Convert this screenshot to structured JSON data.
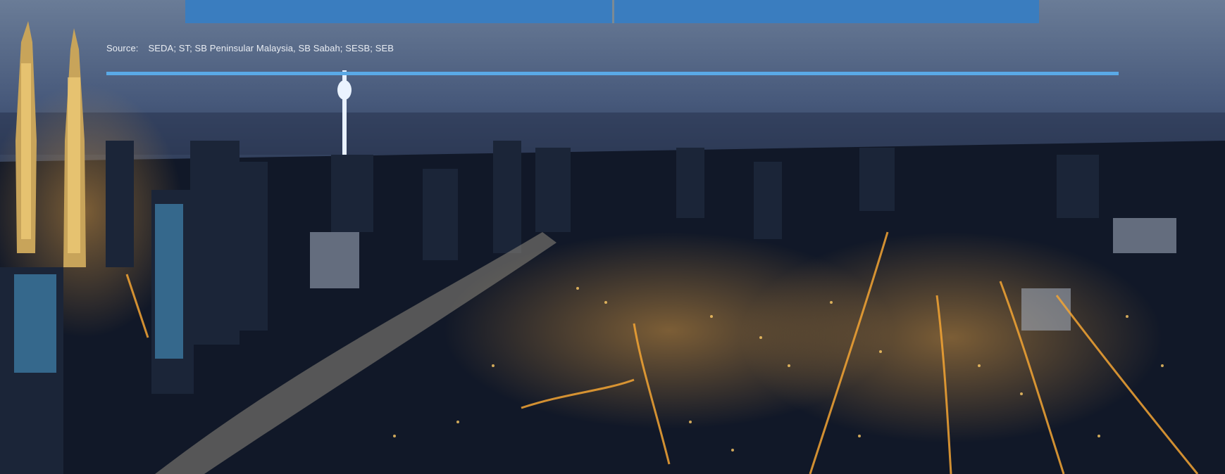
{
  "source": {
    "label": "Source:",
    "text": "SEDA; ST; SB Peninsular Malaysia, SB Sabah; SESB; SEB"
  },
  "table": {
    "left_cell": "",
    "right_cell": ""
  },
  "colors": {
    "table_blue": "#3a7dbf",
    "rule_blue": "#5aa9e6",
    "city_lights": "#f3a534"
  },
  "photo": {
    "icon": "city-skyline-night-photo"
  }
}
